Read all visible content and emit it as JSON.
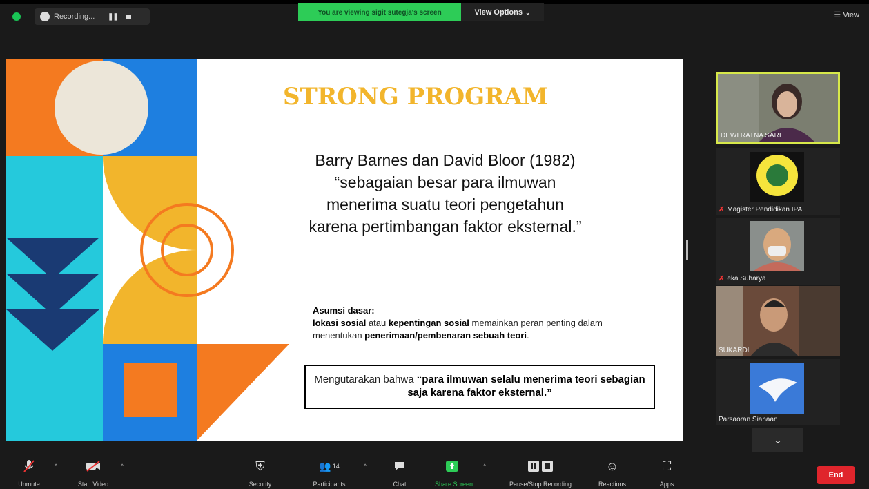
{
  "topbar": {
    "recording_label": "Recording...",
    "viewing_banner": "You are viewing sigit sutegja's screen",
    "view_options": "View Options",
    "view_label": "View"
  },
  "slide": {
    "title": "STRONG PROGRAM",
    "quote_lines": [
      "Barry Barnes dan David Bloor (1982)",
      "“sebagaian besar para ilmuwan",
      "menerima suatu teori pengetahun",
      "karena pertimbangan faktor eksternal.”"
    ],
    "asumsi_heading": "Asumsi dasar:",
    "asumsi_parts": [
      "lokasi sosial",
      " atau ",
      "kepentingan sosial",
      " memainkan peran penting dalam menentukan ",
      "penerimaan/pembenaran sebuah teori",
      "."
    ],
    "box_prefix": "Mengutarakan bahwa ",
    "box_bold": "“para ilmuwan selalu menerima teori sebagian saja karena faktor eksternal.”"
  },
  "participants": [
    {
      "name": "DEWI RATNA SARI",
      "muted": false,
      "active": true
    },
    {
      "name": "Magister Pendidikan IPA",
      "muted": true,
      "active": false
    },
    {
      "name": "eka Suharya",
      "muted": true,
      "active": false
    },
    {
      "name": "SUKARDI",
      "muted": false,
      "active": false
    },
    {
      "name": "Parsaoran Siahaan",
      "muted": false,
      "active": false
    }
  ],
  "toolbar": {
    "unmute": "Unmute",
    "start_video": "Start Video",
    "security": "Security",
    "participants": "Participants",
    "participants_count": "14",
    "chat": "Chat",
    "share_screen": "Share Screen",
    "pause_stop_recording": "Pause/Stop Recording",
    "reactions": "Reactions",
    "apps": "Apps",
    "end": "End"
  },
  "colors": {
    "share_green": "#2dcc57",
    "active_speaker": "#d7e84a",
    "end_red": "#e0252c",
    "orange": "#f47a20",
    "blue": "#1e7fe0",
    "cyan": "#25c9dc",
    "navy": "#1a3a73",
    "yellow": "#f2b52c"
  }
}
